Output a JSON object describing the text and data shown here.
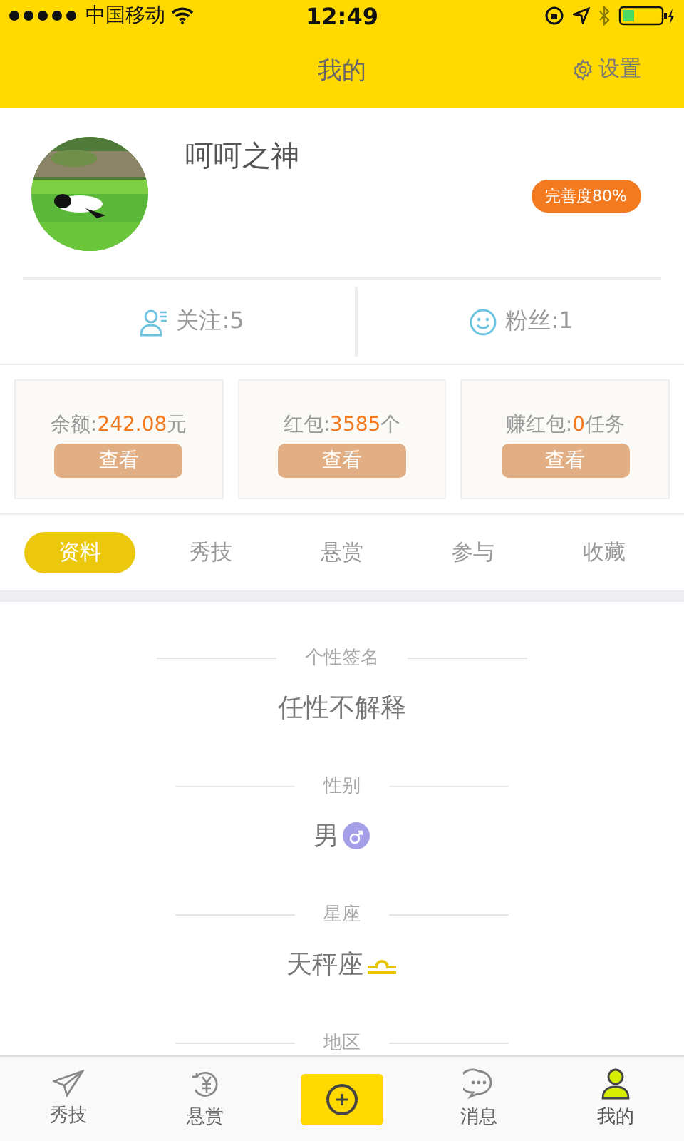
{
  "status_bar": {
    "carrier": "中国移动",
    "time": "12:49"
  },
  "nav": {
    "title": "我的",
    "settings": "设置"
  },
  "profile": {
    "name": "呵呵之神",
    "completeness": "完善度80%"
  },
  "stats": [
    {
      "kind": "follow",
      "label": "关注:5"
    },
    {
      "kind": "fans",
      "label": "粉丝:1"
    }
  ],
  "cards": [
    {
      "label": "余额:",
      "value": "242.08",
      "unit": "元",
      "button": "查看"
    },
    {
      "label": "红包:",
      "value": "3585",
      "unit": "个",
      "button": "查看"
    },
    {
      "label": "赚红包:",
      "value": "0",
      "unit": "任务",
      "button": "查看"
    }
  ],
  "tabs": [
    {
      "label": "资料",
      "selected": true
    },
    {
      "label": "秀技",
      "selected": false
    },
    {
      "label": "悬赏",
      "selected": false
    },
    {
      "label": "参与",
      "selected": false
    },
    {
      "label": "收藏",
      "selected": false
    }
  ],
  "info": [
    {
      "label": "个性签名",
      "value": "任性不解释"
    },
    {
      "label": "性别",
      "value": "男",
      "kind": "male"
    },
    {
      "label": "星座",
      "value": "天秤座",
      "kind": "libra"
    },
    {
      "label": "地区"
    }
  ],
  "tab_bar": [
    {
      "kind": "send",
      "label": "秀技",
      "selected": false
    },
    {
      "kind": "reward",
      "label": "悬赏",
      "selected": false
    },
    {
      "kind": "add",
      "selected": false
    },
    {
      "kind": "message",
      "label": "消息",
      "selected": false
    },
    {
      "kind": "user",
      "label": "我的",
      "selected": true
    }
  ]
}
